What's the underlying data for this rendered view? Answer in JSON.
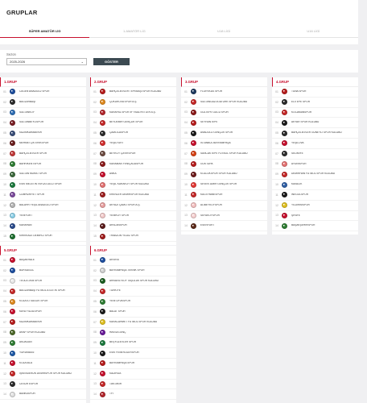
{
  "page": {
    "title": "GRUPLAR"
  },
  "tabs": [
    "SÜPER AMATÖR LİG",
    "1.AMATÖR LİG",
    "U18 LİGİ",
    "U16 LİGİ"
  ],
  "filter": {
    "season_label": "Sezon",
    "season_value": "2025-2026",
    "show_button": "GÖSTER"
  },
  "colors": {
    "accent": "#c8102e",
    "button": "#3c4a52",
    "background": "#f0f0f2"
  },
  "groups": [
    {
      "title": "1.GRUP",
      "teams": [
        {
          "no": "01",
          "name": "ÖZGEN ANADOLU SPOR",
          "color": "#1d4e9e"
        },
        {
          "no": "02",
          "name": "BAĞLARBAŞI",
          "color": "#2a2a2a"
        },
        {
          "no": "03",
          "name": "SULTANKÖY",
          "color": "#2f6eb5"
        },
        {
          "no": "04",
          "name": "SULTANBEYLİSPOR",
          "color": "#7a1d24"
        },
        {
          "no": "05",
          "name": "KAZIMKARABEKİR",
          "color": "#3a4f7a"
        },
        {
          "no": "06",
          "name": "MEHMETÇİK ERİKSPOR",
          "color": "#6b1e1e"
        },
        {
          "no": "07",
          "name": "BAHÇELİEVLER SPOR",
          "color": "#c23a3a"
        },
        {
          "no": "08",
          "name": "BAHRİKENTSPOR",
          "color": "#2e7d32"
        },
        {
          "no": "09",
          "name": "SULTAN MURAT SPOR",
          "color": "#3c6a3c"
        },
        {
          "no": "10",
          "name": "ESKİ MELETİN YAYLA GÜCÜ SPOR",
          "color": "#1b7a3d"
        },
        {
          "no": "11",
          "name": "CUMHURİYET SPOR",
          "color": "#7d4c9e"
        },
        {
          "no": "12",
          "name": "BALAHR YEŞİL ANADOLU SPOR",
          "color": "#b5b5b5"
        },
        {
          "no": "13",
          "name": "YENİYURT",
          "color": "#8dd0e8"
        },
        {
          "no": "14",
          "name": "KARAHAN",
          "color": "#2a4b8d"
        },
        {
          "no": "15",
          "name": "KIRIKKALE DEMİRCİ SPOR",
          "color": "#1d6e2e"
        }
      ]
    },
    {
      "title": "2.GRUP",
      "teams": [
        {
          "no": "01",
          "name": "BAHÇELİEVLER TEPEBAŞI SPOR KULÜBÜ",
          "color": "#b71c1c"
        },
        {
          "no": "02",
          "name": "ÇUKUROVA SPOR A.Ş.",
          "color": "#e08a1e"
        },
        {
          "no": "03",
          "name": "KARAPAL SPORTIF FAALİYETLER A.Ş.",
          "color": "#b3262c"
        },
        {
          "no": "04",
          "name": "BEYDEMİR GENÇLİK SPOR",
          "color": "#c62828"
        },
        {
          "no": "05",
          "name": "ÇAMLICASPOR",
          "color": "#2a2a2a"
        },
        {
          "no": "06",
          "name": "YEŞİLYURT",
          "color": "#d32f2f"
        },
        {
          "no": "07",
          "name": "BEYKÖY ÇAYIRSPOR",
          "color": "#6d4c41"
        },
        {
          "no": "08",
          "name": "KARAMAN YENİÇAĞASPOR",
          "color": "#8b1a1a"
        },
        {
          "no": "09",
          "name": "ANKA",
          "color": "#c8102e"
        },
        {
          "no": "10",
          "name": "YEŞİL KARAKÖY SPOR KULÜBÜ",
          "color": "#e57373"
        },
        {
          "no": "11",
          "name": "ERENLER DEMİRSPOR KULÜBÜ",
          "color": "#9e1f1f"
        },
        {
          "no": "12",
          "name": "AKYAZI ÇAMLI SPOR A.Ş.",
          "color": "#e8a0a0"
        },
        {
          "no": "13",
          "name": "YENİKÖY SPOR",
          "color": "#f1c9c9"
        },
        {
          "no": "14",
          "name": "ARSLANSPOR",
          "color": "#5a1a1a"
        },
        {
          "no": "15",
          "name": "TRABZON YILDIZ SPOR",
          "color": "#a11d1d"
        }
      ]
    },
    {
      "title": "3.GRUP",
      "teams": [
        {
          "no": "01",
          "name": "FLORYA AS SPOR",
          "color": "#1e3a5f"
        },
        {
          "no": "02",
          "name": "SULTANGAZİ ATATÜRK SPOR KULÜBÜ",
          "color": "#c62828"
        },
        {
          "no": "03",
          "name": "GÜLTEPE GÜCÜ SPOR",
          "color": "#8b1a1a"
        },
        {
          "no": "04",
          "name": "SEYRANTEPE",
          "color": "#b71c1c"
        },
        {
          "no": "05",
          "name": "ANADOLU GENÇLİK SPOR",
          "color": "#1a1a1a"
        },
        {
          "no": "06",
          "name": "İSTANBUL BAYRAMPAŞA",
          "color": "#c8102e"
        },
        {
          "no": "07",
          "name": "SANCAKTEPE FUTBOL SPOR KULÜBÜ",
          "color": "#d84315"
        },
        {
          "no": "08",
          "name": "GÖKTÜRK",
          "color": "#b71c1c"
        },
        {
          "no": "09",
          "name": "KOZLUKSPOR SPOR KULÜBÜ",
          "color": "#6d1b1b"
        },
        {
          "no": "10",
          "name": "SEVEN İZMİR GENÇLİK SPOR",
          "color": "#e53935"
        },
        {
          "no": "11",
          "name": "KAĞITHANESPOR",
          "color": "#c62828"
        },
        {
          "no": "12",
          "name": "ALİBEYKÖYSPOR",
          "color": "#f3c0c0"
        },
        {
          "no": "13",
          "name": "SEFAKÖYSPOR",
          "color": "#f6d0d0"
        },
        {
          "no": "14",
          "name": "ESENYURT",
          "color": "#5d2a1a"
        }
      ]
    },
    {
      "title": "4.GRUP",
      "teams": [
        {
          "no": "01",
          "name": "TUNA SPOR",
          "color": "#b71c1c"
        },
        {
          "no": "02",
          "name": "ELİTEPE SPOR",
          "color": "#2a2a2a"
        },
        {
          "no": "03",
          "name": "KOCAMANSPOR",
          "color": "#c62828"
        },
        {
          "no": "04",
          "name": "AKYAR SPOR KULÜBÜ",
          "color": "#1a1a1a"
        },
        {
          "no": "05",
          "name": "BAHÇELİEVLER GÜNEYLİ SPOR KULÜBÜ",
          "color": "#2a2a2a"
        },
        {
          "no": "06",
          "name": "YEŞİLOVA",
          "color": "#c8102e"
        },
        {
          "no": "07",
          "name": "SELİMİYE",
          "color": "#2e2e2e"
        },
        {
          "no": "08",
          "name": "AYDINSPOR",
          "color": "#e57373"
        },
        {
          "no": "09",
          "name": "DEMİRHAN FUTBOL SPOR KULÜBÜ",
          "color": "#c62828"
        },
        {
          "no": "10",
          "name": "KAVACIK",
          "color": "#2f5fa5"
        },
        {
          "no": "11",
          "name": "İNEGÖLSPOR",
          "color": "#1a1a1a"
        },
        {
          "no": "12",
          "name": "YILDIRIMSPOR",
          "color": "#e0c020"
        },
        {
          "no": "13",
          "name": "ŞİFAYE",
          "color": "#c8102e"
        },
        {
          "no": "14",
          "name": "BAŞAKŞEHİRSPOR",
          "color": "#2e7d32"
        }
      ]
    },
    {
      "title": "5.GRUP",
      "teams": [
        {
          "no": "01",
          "name": "BAŞAKHALE",
          "color": "#c8102e"
        },
        {
          "no": "02",
          "name": "BURSAGÜC",
          "color": "#1e4fa0"
        },
        {
          "no": "03",
          "name": "TEOLA 1904 SPOR",
          "color": "#e8e8e8"
        },
        {
          "no": "04",
          "name": "BAĞLARBAŞI FUTBOL ATLETİK SPOR",
          "color": "#c62828"
        },
        {
          "no": "05",
          "name": "KOZATLI SAĞLIK SPOR",
          "color": "#e08a1e"
        },
        {
          "no": "06",
          "name": "KAYA YILDIZSPOR",
          "color": "#c8102e"
        },
        {
          "no": "07",
          "name": "KAZIMKARABEKİR",
          "color": "#b71c1c"
        },
        {
          "no": "08",
          "name": "ARAP SPOR KULÜBÜ",
          "color": "#4e6a2a"
        },
        {
          "no": "09",
          "name": "AKDAĞAN",
          "color": "#2e7d32"
        },
        {
          "no": "10",
          "name": "YURUKBASI",
          "color": "#1e5aa8"
        },
        {
          "no": "11",
          "name": "KOZATALA",
          "color": "#c8102e"
        },
        {
          "no": "12",
          "name": "İŞKENDERUN DEMİRSPOR SPOR KULÜBÜ",
          "color": "#c62828"
        },
        {
          "no": "13",
          "name": "CESUR ESPOR",
          "color": "#2a2a2a"
        },
        {
          "no": "14",
          "name": "BANKASPOR",
          "color": "#e0e0e0"
        }
      ]
    },
    {
      "title": "6.GRUP",
      "teams": [
        {
          "no": "01",
          "name": "AKVİRA",
          "color": "#1e4fa0"
        },
        {
          "no": "02",
          "name": "BAYRAMPAŞA TEKNİK SPOR",
          "color": "#d0d0d0"
        },
        {
          "no": "03",
          "name": "ARNAVUTKÖY TAŞOLUK SPOR KULÜBÜ",
          "color": "#1b5e20"
        },
        {
          "no": "04",
          "name": "TÜRKİYE",
          "color": "#c62828"
        },
        {
          "no": "05",
          "name": "YENİ UFUKSPOR",
          "color": "#2e7d32"
        },
        {
          "no": "06",
          "name": "BALAT SPOR",
          "color": "#1a1a1a"
        },
        {
          "no": "07",
          "name": "KARACAHMET FUTBOL SPOR KULÜBÜ",
          "color": "#e0c020"
        },
        {
          "no": "08",
          "name": "HAVSA GENÇ",
          "color": "#6a1b9a"
        },
        {
          "no": "09",
          "name": "BEŞYÜZEVLER SPOR",
          "color": "#1b7a3d"
        },
        {
          "no": "10",
          "name": "ESKİ FENERLİLERSPOR",
          "color": "#1a1a1a"
        },
        {
          "no": "11",
          "name": "BAYRAMPAŞA SPOR",
          "color": "#b71c1c"
        },
        {
          "no": "12",
          "name": "KADIRGA",
          "color": "#c8102e"
        },
        {
          "no": "13",
          "name": "TAKTAKIR",
          "color": "#c62828"
        },
        {
          "no": "14",
          "name": "TFT",
          "color": "#b3262c"
        }
      ]
    }
  ]
}
